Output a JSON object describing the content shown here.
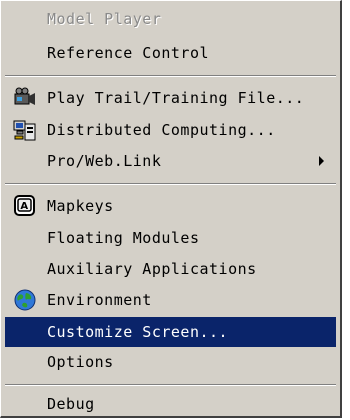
{
  "menu": {
    "items": [
      {
        "label": "Model Player",
        "disabled": true
      },
      {
        "label": "Reference Control"
      },
      {
        "label": "Play Trail/Training File...",
        "icon": "video-camera-icon"
      },
      {
        "label": "Distributed Computing...",
        "icon": "computers-icon"
      },
      {
        "label": "Pro/Web.Link",
        "submenu": true
      },
      {
        "label": "Mapkeys",
        "icon": "key-icon"
      },
      {
        "label": "Floating Modules"
      },
      {
        "label": "Auxiliary Applications"
      },
      {
        "label": "Environment",
        "icon": "globe-icon"
      },
      {
        "label": "Customize Screen...",
        "highlighted": true
      },
      {
        "label": "Options"
      },
      {
        "label": "Debug"
      }
    ]
  },
  "colors": {
    "menu_background": "#d4d0c8",
    "highlight_background": "#0a246a",
    "highlight_text": "#ffffff",
    "disabled_text": "#8a8a8a"
  }
}
